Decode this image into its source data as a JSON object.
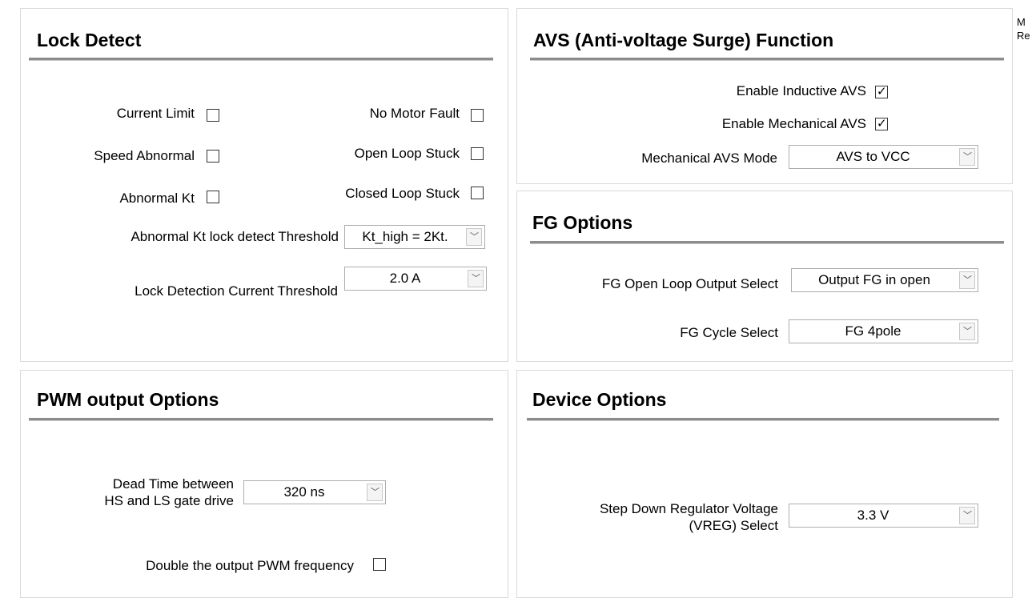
{
  "lock_detect": {
    "title": "Lock Detect",
    "current_limit": "Current Limit",
    "no_motor_fault": "No Motor Fault",
    "speed_abnormal": "Speed Abnormal",
    "open_loop_stuck": "Open Loop Stuck",
    "abnormal_kt": "Abnormal Kt",
    "closed_loop_stuck": "Closed Loop Stuck",
    "kt_threshold_label": "Abnormal Kt lock detect Threshold",
    "kt_threshold_value": "Kt_high = 2Kt.",
    "current_threshold_label": "Lock Detection Current Threshold",
    "current_threshold_value": "2.0 A"
  },
  "avs": {
    "title": "AVS (Anti-voltage Surge) Function",
    "enable_inductive": "Enable Inductive AVS",
    "enable_mechanical": "Enable Mechanical AVS",
    "mode_label": "Mechanical AVS Mode",
    "mode_value": "AVS to VCC",
    "check_mark": "✓"
  },
  "fg": {
    "title": "FG Options",
    "open_loop_label": "FG Open Loop Output Select",
    "open_loop_value": "Output FG in open",
    "cycle_label": "FG Cycle Select",
    "cycle_value": "FG 4pole"
  },
  "pwm": {
    "title": "PWM output Options",
    "dead_time_label_1": "Dead Time between",
    "dead_time_label_2": "HS and LS gate drive",
    "dead_time_value": "320 ns",
    "double_freq": "Double the output PWM frequency"
  },
  "device": {
    "title": "Device Options",
    "vreg_label_1": "Step Down Regulator Voltage",
    "vreg_label_2": "(VREG) Select",
    "vreg_value": "3.3 V"
  },
  "corner": {
    "line1": "M",
    "line2": "Re"
  },
  "icons": {
    "dropdown": "chevron-down-icon",
    "checkbox": "checkbox-icon"
  }
}
